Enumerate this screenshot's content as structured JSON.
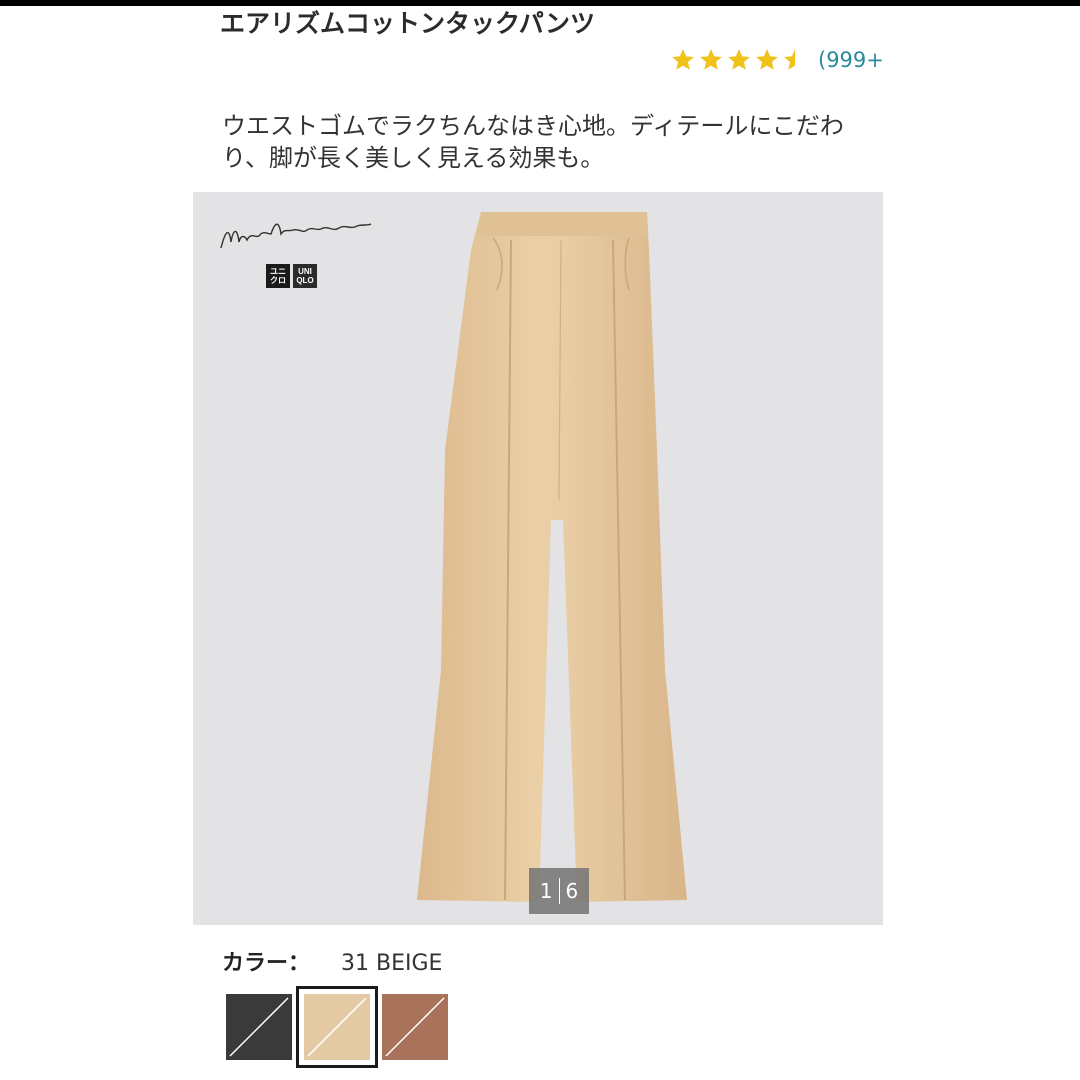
{
  "product": {
    "title": "エアリズムコットンタックパンツ",
    "rating_stars": 4.5,
    "review_count": "(999+",
    "description": "ウエストゴムでラクちんなはき心地。ディテールにこだわり、脚が長く美しく見える効果も。"
  },
  "gallery": {
    "current": "1",
    "total": "6",
    "background_color": "#e3e3e5",
    "product_color": "#e8c9a0",
    "logo_left": "ユニクロ",
    "logo_right": "UNIQLO"
  },
  "color": {
    "label": "カラー：",
    "value": "31 BEIGE",
    "swatches": [
      {
        "name": "black",
        "color": "#3a3a3a",
        "selected": false
      },
      {
        "name": "beige",
        "color": "#e4c9a5",
        "selected": true
      },
      {
        "name": "brown",
        "color": "#a8735a",
        "selected": false
      }
    ]
  },
  "colors": {
    "star": "#f0c21a",
    "link": "#2a8a9c"
  }
}
